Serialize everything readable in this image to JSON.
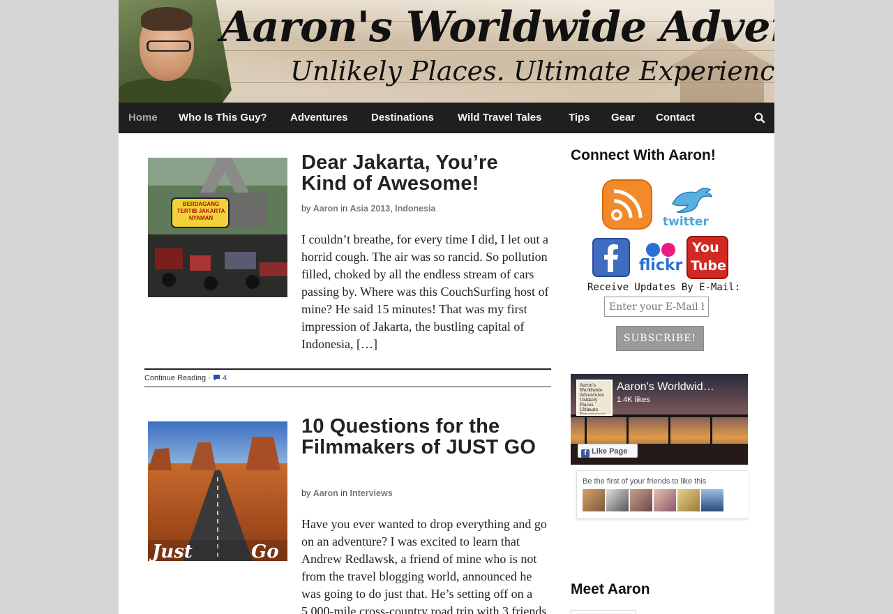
{
  "header": {
    "title": "Aaron's Worldwide Adventures",
    "tagline": "Unlikely Places. Ultimate Experiences."
  },
  "nav": {
    "items": [
      {
        "label": "Home",
        "active": true
      },
      {
        "label": "Who Is This Guy?"
      },
      {
        "label": "Adventures"
      },
      {
        "label": "Destinations"
      },
      {
        "label": "Wild Travel Tales"
      },
      {
        "label": "Tips"
      },
      {
        "label": "Gear"
      },
      {
        "label": "Contact"
      }
    ],
    "search_icon": "search-icon"
  },
  "posts": [
    {
      "title": "Dear Jakarta, You’re Kind of Awesome!",
      "by": "by",
      "author": "Aaron",
      "in": "in",
      "categories": [
        "Asia 2013",
        "Indonesia"
      ],
      "excerpt": "I couldn’t breathe, for every time I did, I let out a horrid cough. The air was so rancid. So pollution filled, choked by all the endless stream of cars passing by. Where was this CouchSurfing host of mine? He said 15 minutes! That was my first impression of Jakarta, the bustling capital of Indonesia, […]",
      "continue": "Continue Reading",
      "sep": "·",
      "comments": "4",
      "thumb_sign": "BERDAGANG TERTIB JAKARTA NYAMAN"
    },
    {
      "title": "10 Questions for the Filmmakers of JUST GO",
      "by": "by",
      "author": "Aaron",
      "in": "in",
      "categories": [
        "Interviews"
      ],
      "excerpt": "Have you ever wanted to drop everything and go on an adventure? I was excited to learn that Andrew Redlawsk, a friend of mine who is not from the travel blogging world, announced he was going to do just that. He’s setting off on a 5,000-mile cross-country road trip with 3 friends with a tent and a […]",
      "thumb_left": "Just",
      "thumb_right": "Go"
    }
  ],
  "sidebar": {
    "connect_title": "Connect With Aaron!",
    "social": [
      "rss-icon",
      "twitter-icon",
      "facebook-icon",
      "flickr-icon",
      "youtube-icon"
    ],
    "twitter_label": "twitter",
    "flickr_label": "flickr",
    "youtube_label_top": "You",
    "youtube_label_bottom": "Tube",
    "receive_label": "Receive Updates By E-Mail:",
    "email_placeholder": "Enter your E-Mail h",
    "subscribe_label": "SUBSCRIBE!",
    "facebook": {
      "page_name": "Aaron's Worldwid…",
      "likes": "1.4K likes",
      "like_button": "Like Page",
      "friends_text": "Be the first of your friends to like this",
      "logo_text": "Aaron's Worldwide Adventures Unlikely Places Ultimate Experiences"
    },
    "meet_title": "Meet Aaron"
  }
}
